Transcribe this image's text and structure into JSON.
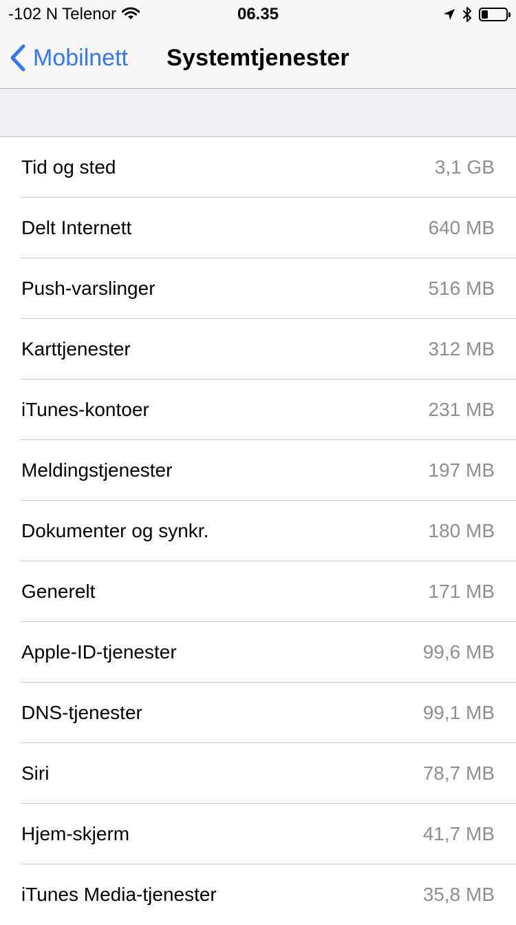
{
  "status_bar": {
    "carrier": "-102 N Telenor",
    "time": "06.35",
    "battery_level": 0.25
  },
  "nav": {
    "back_label": "Mobilnett",
    "title": "Systemtjenester"
  },
  "services": [
    {
      "name": "Tid og sted",
      "usage": "3,1 GB"
    },
    {
      "name": "Delt Internett",
      "usage": "640 MB"
    },
    {
      "name": "Push-varslinger",
      "usage": "516 MB"
    },
    {
      "name": "Karttjenester",
      "usage": "312 MB"
    },
    {
      "name": "iTunes-kontoer",
      "usage": "231 MB"
    },
    {
      "name": "Meldingstjenester",
      "usage": "197 MB"
    },
    {
      "name": "Dokumenter og synkr.",
      "usage": "180 MB"
    },
    {
      "name": "Generelt",
      "usage": "171 MB"
    },
    {
      "name": "Apple-ID-tjenester",
      "usage": "99,6 MB"
    },
    {
      "name": "DNS-tjenester",
      "usage": "99,1 MB"
    },
    {
      "name": "Siri",
      "usage": "78,7 MB"
    },
    {
      "name": "Hjem-skjerm",
      "usage": "41,7 MB"
    },
    {
      "name": "iTunes Media-tjenester",
      "usage": "35,8 MB"
    }
  ],
  "colors": {
    "accent": "#3478f6",
    "secondary_text": "#8e8e93",
    "grouped_background": "#efeff4"
  },
  "icons": [
    "wifi-icon",
    "location-arrow-icon",
    "bluetooth-icon",
    "battery-icon",
    "chevron-left-icon"
  ]
}
